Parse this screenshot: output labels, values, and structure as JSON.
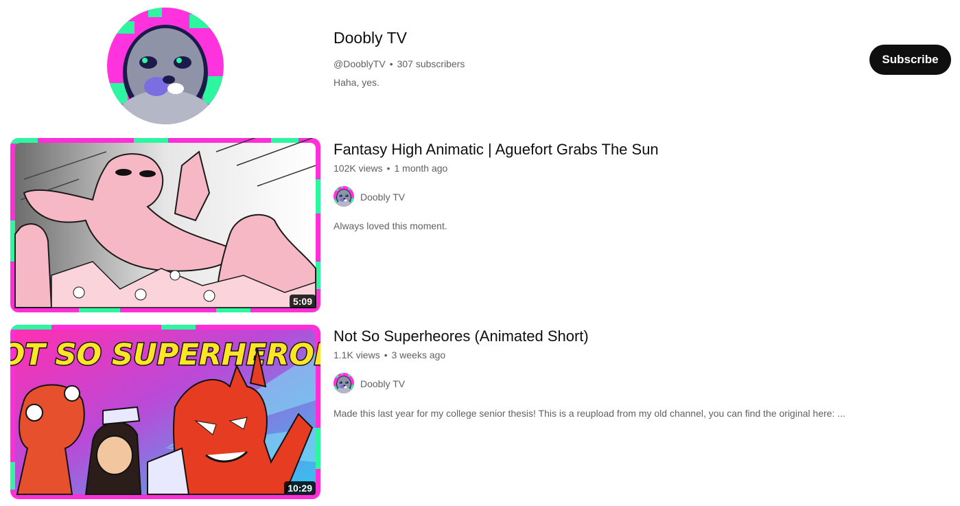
{
  "channel": {
    "name": "Doobly TV",
    "handle": "@DooblyTV",
    "separator": "•",
    "subscribers": "307 subscribers",
    "description": "Haha, yes.",
    "subscribe_label": "Subscribe",
    "avatar_icon": "seal-avatar-icon"
  },
  "videos": [
    {
      "title": "Fantasy High Animatic | Aguefort Grabs The Sun",
      "views": "102K views",
      "separator": "•",
      "age": "1 month ago",
      "channel": "Doobly TV",
      "description": "Always loved this moment.",
      "duration": "5:09"
    },
    {
      "title": "Not So Superheores (Animated Short)",
      "views": "1.1K views",
      "separator": "•",
      "age": "3 weeks ago",
      "channel": "Doobly TV",
      "description": "Made this last year for my college senior thesis! This is a reupload from my old channel, you can find the original here: ...",
      "duration": "10:29",
      "thumbnail_text": "NOT SO SUPERHEROES"
    }
  ],
  "colors": {
    "border_pink": "#ff2fd8",
    "border_green": "#2ef5a0",
    "subscribe_bg": "#0f0f0f"
  }
}
